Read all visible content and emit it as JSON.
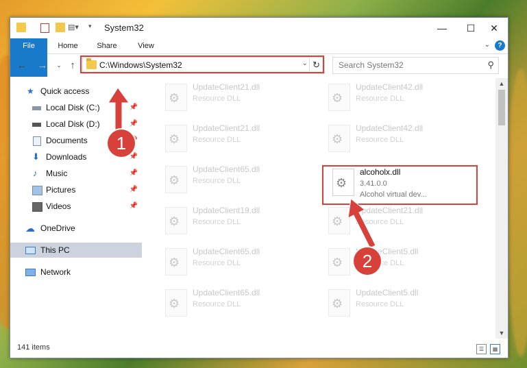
{
  "window": {
    "title": "System32",
    "controls": {
      "minimize": "—",
      "maximize": "☐",
      "close": "✕"
    }
  },
  "ribbon": {
    "tabs": [
      "File",
      "Home",
      "Share",
      "View"
    ],
    "help": "?"
  },
  "nav": {
    "address": "C:\\Windows\\System32",
    "search_placeholder": "Search System32"
  },
  "sidebar": {
    "items": [
      {
        "label": "Quick access",
        "icon": "star-icon",
        "pinned": false
      },
      {
        "label": "Local Disk (C:)",
        "icon": "drive-icon",
        "pinned": true
      },
      {
        "label": "Local Disk (D:)",
        "icon": "drive-icon",
        "pinned": true
      },
      {
        "label": "Documents",
        "icon": "documents-icon",
        "pinned": true
      },
      {
        "label": "Downloads",
        "icon": "download-icon",
        "pinned": true
      },
      {
        "label": "Music",
        "icon": "music-icon",
        "pinned": true
      },
      {
        "label": "Pictures",
        "icon": "pictures-icon",
        "pinned": true
      },
      {
        "label": "Videos",
        "icon": "videos-icon",
        "pinned": true
      },
      {
        "label": "OneDrive",
        "icon": "cloud-icon",
        "pinned": false
      },
      {
        "label": "This PC",
        "icon": "computer-icon",
        "pinned": false,
        "selected": true
      },
      {
        "label": "Network",
        "icon": "network-icon",
        "pinned": false
      }
    ]
  },
  "files": [
    {
      "name": "UpdateClient21.dll",
      "desc": "Resource DLL"
    },
    {
      "name": "UpdateClient42.dll",
      "desc": "Resource DLL"
    },
    {
      "name": "UpdateClient21.dll",
      "desc": "Resource DLL"
    },
    {
      "name": "UpdateClient42.dll",
      "desc": "Resource DLL"
    },
    {
      "name": "UpdateClient65.dll",
      "desc": "Resource DLL"
    },
    {
      "name": "alcoholx.dll",
      "desc": "3.41.0.0",
      "desc2": "Alcohol virtual dev...",
      "active": true
    },
    {
      "name": "UpdateClient19.dll",
      "desc": "Resource DLL"
    },
    {
      "name": "UpdateClient21.dll",
      "desc": "Resource DLL"
    },
    {
      "name": "UpdateClient65.dll",
      "desc": "Resource DLL"
    },
    {
      "name": "UpdateClient5.dll",
      "desc": "Resource DLL"
    },
    {
      "name": "UpdateClient65.dll",
      "desc": "Resource DLL"
    },
    {
      "name": "UpdateClient5.dll",
      "desc": "Resource DLL"
    }
  ],
  "status": {
    "count": "141 items"
  },
  "annotations": {
    "step1": "1",
    "step2": "2"
  },
  "colors": {
    "accent": "#1979ca",
    "highlight": "#d8403a"
  }
}
